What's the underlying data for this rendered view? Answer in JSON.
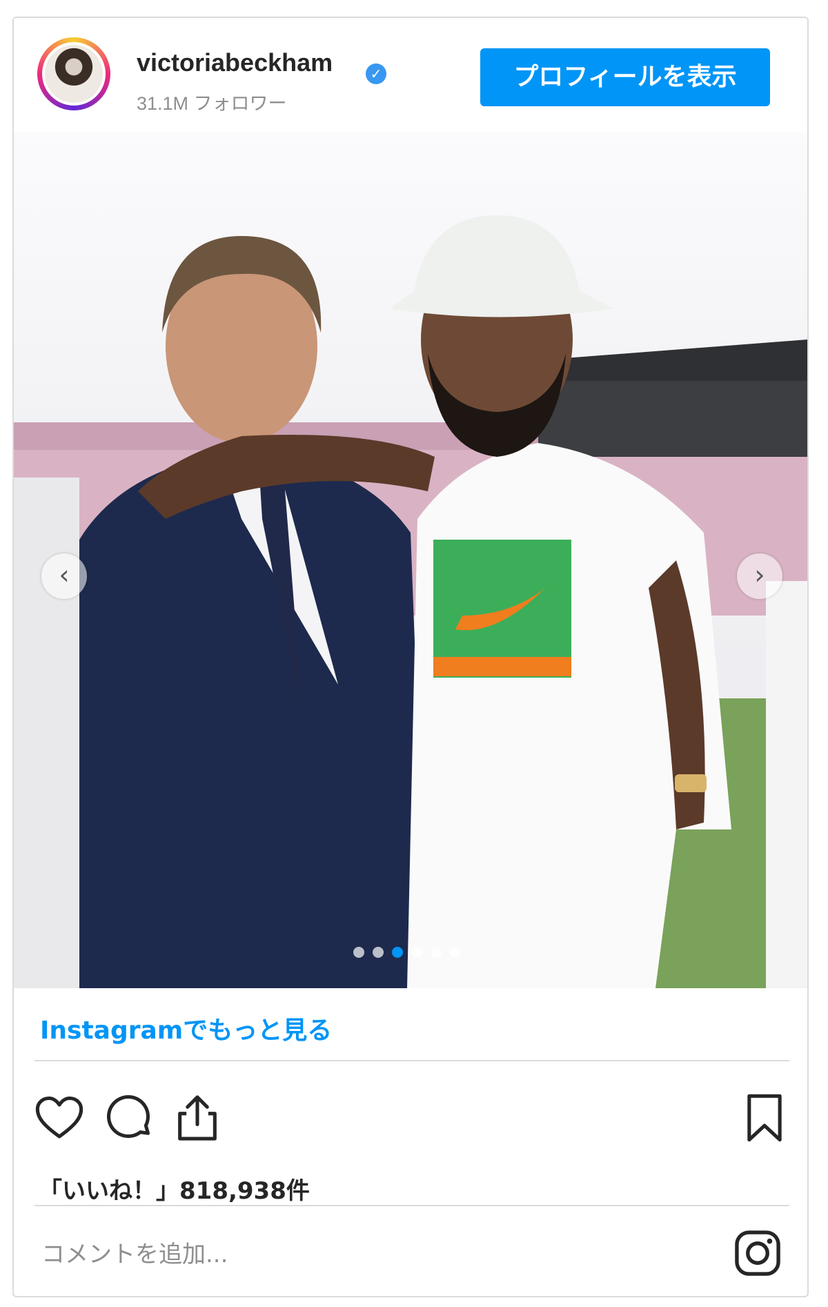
{
  "header": {
    "username": "victoriabeckham",
    "followers": "31.1M フォロワー",
    "verified_mark": "✓",
    "view_profile_label": "プロフィールを表示"
  },
  "carousel": {
    "prev_glyph": "‹",
    "next_glyph": "›",
    "dot_count": 6,
    "active_index": 2
  },
  "more_link": "Instagramでもっと見る",
  "likes_text": "「いいね！」818,938件",
  "comment_placeholder": "コメントを追加...",
  "icons": {
    "like": "heart-icon",
    "comment": "comment-icon",
    "share": "share-icon",
    "save": "bookmark-icon",
    "instagram": "instagram-icon"
  },
  "colors": {
    "accent": "#0095f6",
    "border": "#dbdbdb",
    "muted_text": "#8e8e8e",
    "text": "#262626"
  }
}
